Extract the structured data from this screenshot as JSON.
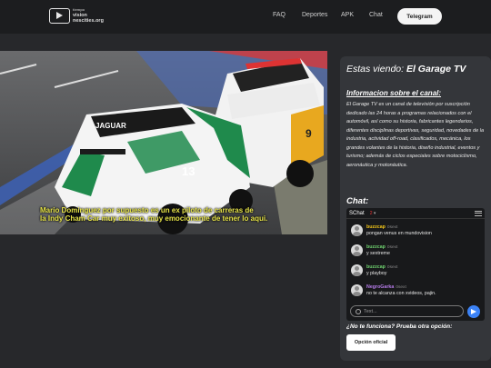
{
  "header": {
    "logo_small": "tiempo",
    "logo_main": "vision",
    "logo_sub": "nescities.org",
    "nav": [
      "FAQ",
      "Deportes",
      "APK",
      "Chat"
    ],
    "telegram_label": "Telegram"
  },
  "video": {
    "subtitle_line1": "Mario Dominguez por supuesto es un ex piloto de carreras de",
    "subtitle_line2": "la Indy Cham Car muy exitoso, muy emocionante de tener lo aqui.",
    "car_front_number": "13",
    "car_back_number": "9",
    "brand": "JAGUAR"
  },
  "panel": {
    "watching_prefix": "Estas viendo:",
    "channel_name": "El Garage TV",
    "info_heading": "Informacion sobre el canal:",
    "info_text": "El Garage TV es un canal de televisión por suscripción dedicado las 24 horas a programas relacionados con el automóvil, así como su historia, fabricantes legendarios, diferentes disciplinas deportivas, seguridad, novedades de la industria, actividad off-road, clasificados, mecánica, los grandes volantes de la historia, diseño industrial, eventos y turismo; además de ciclos especiales sobre motociclismo, aeronáutica y motonáutica.",
    "chat_heading": "Chat:",
    "alt_question": "¿No te funciona? Prueba otra opción:",
    "alt_button": "Opción oficial"
  },
  "chat": {
    "brand": "SChat",
    "count": "2",
    "input_placeholder": "Text...",
    "messages": [
      {
        "user": "buzzcap",
        "time": "0sext",
        "text": "pongan venus en mundovision",
        "color": "#f0c419"
      },
      {
        "user": "buzzcap",
        "time": "0sext",
        "text": "y sextreme",
        "color": "#6ed06e"
      },
      {
        "user": "buzzcap",
        "time": "0sext",
        "text": "y playboy",
        "color": "#6ed06e"
      },
      {
        "user": "NegroGarka",
        "time": "0sext",
        "text": "no te alcanza con xvideos, pajin.",
        "color": "#b57be8"
      }
    ]
  },
  "colors": {
    "accent_blue": "#3b82f6",
    "subtitle_yellow": "#e8e54a"
  }
}
